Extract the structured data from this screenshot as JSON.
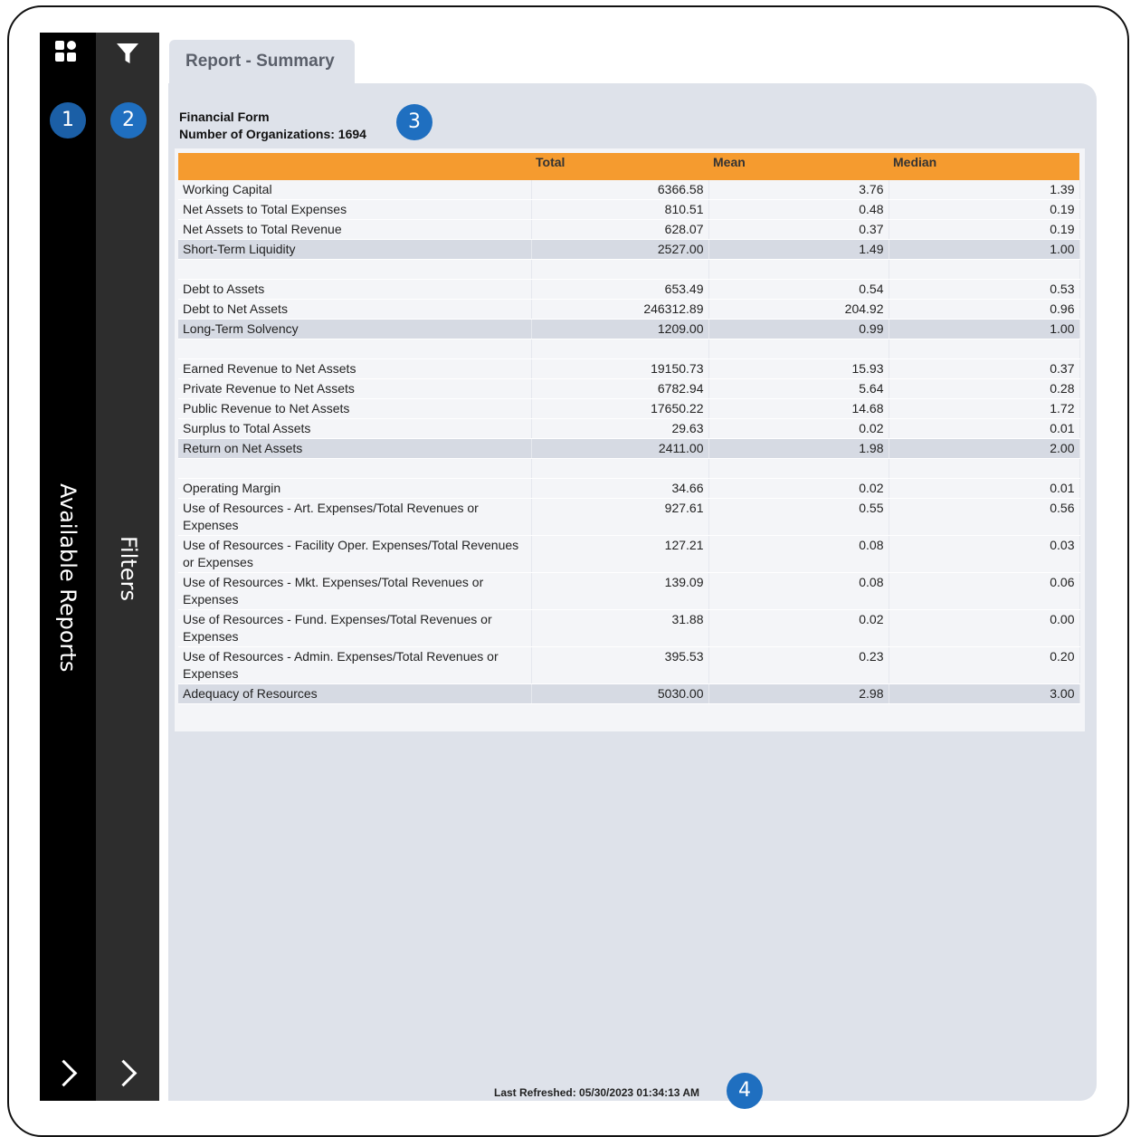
{
  "sidebar": {
    "available_reports_label": "Available Reports",
    "filters_label": "Filters",
    "icons": [
      "grid-icon",
      "filter-icon",
      "chevron-right-icon"
    ]
  },
  "badges": [
    "1",
    "2",
    "3",
    "4"
  ],
  "tab": {
    "label": "Report - Summary"
  },
  "report": {
    "form_name": "Financial Form",
    "org_count_label": "Number of Organizations: 1694"
  },
  "table": {
    "columns": [
      "",
      "Total",
      "Mean",
      "Median"
    ],
    "rows": [
      {
        "label": "Working Capital",
        "total": "6366.58",
        "mean": "3.76",
        "median": "1.39",
        "type": "row"
      },
      {
        "label": "Net Assets to Total Expenses",
        "total": "810.51",
        "mean": "0.48",
        "median": "0.19",
        "type": "row"
      },
      {
        "label": "Net Assets to Total Revenue",
        "total": "628.07",
        "mean": "0.37",
        "median": "0.19",
        "type": "row"
      },
      {
        "label": "Short-Term Liquidity",
        "total": "2527.00",
        "mean": "1.49",
        "median": "1.00",
        "type": "subtotal"
      },
      {
        "label": "",
        "total": "",
        "mean": "",
        "median": "",
        "type": "spacer"
      },
      {
        "label": "Debt to Assets",
        "total": "653.49",
        "mean": "0.54",
        "median": "0.53",
        "type": "row"
      },
      {
        "label": "Debt to Net Assets",
        "total": "246312.89",
        "mean": "204.92",
        "median": "0.96",
        "type": "row"
      },
      {
        "label": "Long-Term Solvency",
        "total": "1209.00",
        "mean": "0.99",
        "median": "1.00",
        "type": "subtotal"
      },
      {
        "label": "",
        "total": "",
        "mean": "",
        "median": "",
        "type": "spacer"
      },
      {
        "label": "Earned Revenue to Net Assets",
        "total": "19150.73",
        "mean": "15.93",
        "median": "0.37",
        "type": "row"
      },
      {
        "label": "Private Revenue to Net Assets",
        "total": "6782.94",
        "mean": "5.64",
        "median": "0.28",
        "type": "row"
      },
      {
        "label": "Public Revenue to Net Assets",
        "total": "17650.22",
        "mean": "14.68",
        "median": "1.72",
        "type": "row"
      },
      {
        "label": "Surplus to Total Assets",
        "total": "29.63",
        "mean": "0.02",
        "median": "0.01",
        "type": "row"
      },
      {
        "label": "Return on Net Assets",
        "total": "2411.00",
        "mean": "1.98",
        "median": "2.00",
        "type": "subtotal"
      },
      {
        "label": "",
        "total": "",
        "mean": "",
        "median": "",
        "type": "spacer"
      },
      {
        "label": "Operating Margin",
        "total": "34.66",
        "mean": "0.02",
        "median": "0.01",
        "type": "row"
      },
      {
        "label": "Use of Resources - Art. Expenses/Total Revenues or Expenses",
        "total": "927.61",
        "mean": "0.55",
        "median": "0.56",
        "type": "row"
      },
      {
        "label": "Use of Resources - Facility Oper. Expenses/Total Revenues or Expenses",
        "total": "127.21",
        "mean": "0.08",
        "median": "0.03",
        "type": "row"
      },
      {
        "label": "Use of Resources - Mkt. Expenses/Total Revenues or Expenses",
        "total": "139.09",
        "mean": "0.08",
        "median": "0.06",
        "type": "row"
      },
      {
        "label": "Use of Resources - Fund. Expenses/Total Revenues or Expenses",
        "total": "31.88",
        "mean": "0.02",
        "median": "0.00",
        "type": "row"
      },
      {
        "label": "Use of Resources - Admin. Expenses/Total Revenues or Expenses",
        "total": "395.53",
        "mean": "0.23",
        "median": "0.20",
        "type": "row"
      },
      {
        "label": "Adequacy of Resources",
        "total": "5030.00",
        "mean": "2.98",
        "median": "3.00",
        "type": "subtotal"
      }
    ]
  },
  "footer": {
    "last_refreshed": "Last Refreshed: 05/30/2023 01:34:13 AM"
  },
  "colors": {
    "header_orange": "#f59b2f",
    "badge_blue": "#1f6fc0",
    "rail_black": "#000000",
    "rail_gray": "#2d2d2d",
    "content_bg": "#dee2ea"
  }
}
